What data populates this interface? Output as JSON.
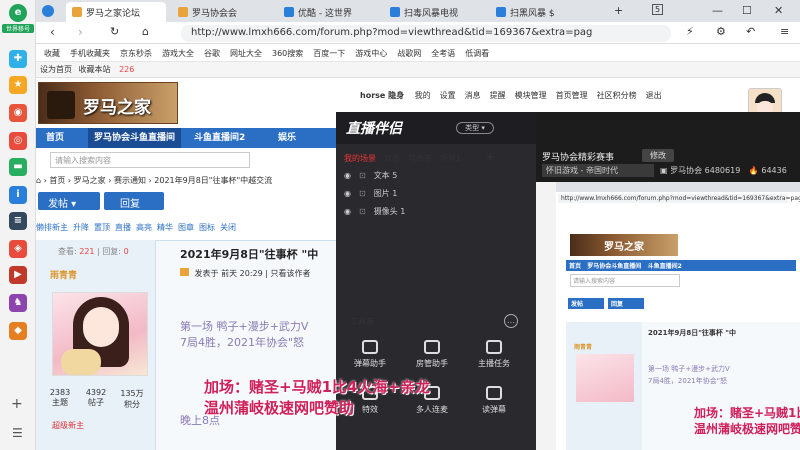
{
  "app": {
    "badge": "世界移号"
  },
  "tabs": [
    {
      "label": "罗马之家论坛",
      "active": true,
      "color": "#e8a33a"
    },
    {
      "label": "罗马协会会",
      "active": false,
      "color": "#e8a33a"
    },
    {
      "label": "优酷 - 这世界",
      "active": false,
      "color": "#2a7fdb"
    },
    {
      "label": "扫毒风暴电视",
      "active": false,
      "color": "#2a7fdb"
    },
    {
      "label": "扫黑风暴 $",
      "active": false,
      "color": "#2a7fdb"
    }
  ],
  "window": {
    "new_tab": "+",
    "tab_count": "5",
    "minimize": "—",
    "maximize": "☐",
    "close": "✕"
  },
  "address": {
    "url": "http://www.lmxh666.com/forum.php?mod=viewthread&tid=169367&extra=pag"
  },
  "bookmarks": [
    "收藏",
    "手机收藏夹",
    "京东秒杀",
    "游戏大全",
    "谷歌",
    "网址大全",
    "360搜索",
    "百度一下",
    "游戏中心",
    "战歌网",
    "全考语",
    "低调看"
  ],
  "site": {
    "top_left": "设为首页",
    "top_fav": "收藏本站",
    "top_count": "226",
    "logo_text": "罗马之家",
    "user": "horse 隐身",
    "user_links": [
      "我的",
      "设置",
      "消息",
      "提醒",
      "模块管理",
      "首页管理",
      "社区积分榜",
      "退出"
    ],
    "nav": [
      {
        "label": "首页",
        "selected": false
      },
      {
        "label": "罗马协会斗鱼直播间",
        "selected": true
      },
      {
        "label": "斗鱼直播间2",
        "selected": false
      },
      {
        "label": "娱乐",
        "selected": false
      }
    ],
    "search_placeholder": "请输入搜索内容",
    "breadcrumb": [
      "首页",
      "罗马之家",
      "赛示通知",
      "2021年9月8日\"往事杯\"中越交流"
    ],
    "post_button": "发帖",
    "reply_button": "回复",
    "tags": [
      "懒排新主",
      "升降",
      "置顶",
      "直播",
      "高亮",
      "精华",
      "图章",
      "图标",
      "关闭"
    ],
    "views_label": "查看:",
    "views": "221",
    "replies_label": "回复:",
    "replies": "0"
  },
  "post": {
    "author": "雨青青",
    "stats": [
      {
        "value": "2383",
        "label": "主题"
      },
      {
        "value": "4392",
        "label": "帖子"
      },
      {
        "value": "135万",
        "label": "积分"
      }
    ],
    "rank": "超级新主",
    "title": "2021年9月8日\"往事杯 \"中",
    "meta_prefix": "发表于",
    "meta_time": "前天 20:29",
    "meta_rest": "只看该作者",
    "line1": "第一场 鸭子+漫步+武力V",
    "line2": "7局4胜，2021年协会\"怒",
    "line3": "晚上8点"
  },
  "overlay": {
    "line1": "加场：赌圣+马贼1比4火海+亲龙",
    "line2": "温州蒲岐极速网吧赞助"
  },
  "stream": {
    "logo": "直播伴侣",
    "badge": "类型 ▾",
    "tabs": [
      "我的场景",
      "双击",
      "可改名",
      "场景1"
    ],
    "add": "+",
    "sources": [
      {
        "label": "文本 5"
      },
      {
        "label": "图片 1"
      },
      {
        "label": "摄像头 1"
      }
    ],
    "tools_title": "工具箱",
    "tools": [
      "弹幕助手",
      "房管助手",
      "主播任务",
      "特效",
      "多人连麦",
      "读弹幕"
    ]
  },
  "preview": {
    "title": "罗马协会精彩赛事",
    "edit": "修改",
    "category": "怀旧游戏 - 帝国时代",
    "fans_label": "罗马协会",
    "fans": "6480619",
    "hot": "64436"
  }
}
